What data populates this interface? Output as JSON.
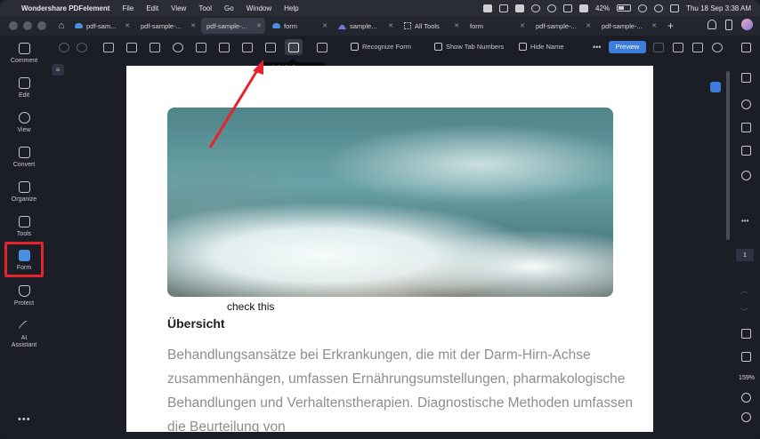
{
  "menubar": {
    "app_name": "Wondershare PDFelement",
    "menus": [
      "File",
      "Edit",
      "View",
      "Tool",
      "Go",
      "Window",
      "Help"
    ],
    "battery": "42%",
    "datetime": "Thu 18 Sep  3:38 AM"
  },
  "tabs": [
    {
      "label": "pdf-sam...",
      "icon": "cloud-icon",
      "active": false
    },
    {
      "label": "pdf-sample-...",
      "icon": "",
      "active": false
    },
    {
      "label": "pdf-sample-...",
      "icon": "",
      "active": true
    },
    {
      "label": "form",
      "icon": "cloud-icon",
      "active": false
    },
    {
      "label": "sample...",
      "icon": "chart-icon",
      "active": false
    },
    {
      "label": "All Tools",
      "icon": "grid-icon",
      "active": false
    },
    {
      "label": "form",
      "icon": "",
      "active": false
    },
    {
      "label": "pdf-sample-...",
      "icon": "",
      "active": false
    },
    {
      "label": "pdf-sample-...",
      "icon": "",
      "active": false
    }
  ],
  "sidebar": {
    "items": [
      {
        "label": "Comment",
        "icon": "comment-icon"
      },
      {
        "label": "Edit",
        "icon": "edit-icon"
      },
      {
        "label": "View",
        "icon": "eye-icon"
      },
      {
        "label": "Convert",
        "icon": "convert-icon"
      },
      {
        "label": "Organize",
        "icon": "organize-icon"
      },
      {
        "label": "Tools",
        "icon": "toolbox-icon"
      },
      {
        "label": "Form",
        "icon": "form-icon"
      },
      {
        "label": "Protect",
        "icon": "shield-icon"
      },
      {
        "label": "AI\nAssistant",
        "icon": "ai-wand-icon"
      }
    ],
    "more": "•••"
  },
  "toolbar": {
    "recognize_form": "Recognize Form",
    "show_tab_numbers": "Show Tab Numbers",
    "hide_name": "Hide Name",
    "more": "•••",
    "preview": "Preview",
    "tooltip": "Digital Signature"
  },
  "document": {
    "caption": "check this",
    "heading": "Übersicht",
    "paragraph": "Behandlungsansätze bei Erkrankungen, die mit der Darm-Hirn-Achse zusammenhängen, umfassen Ernährungsumstellungen, pharmakologische Behandlungen und Verhaltenstherapien. Diagnostische Methoden umfassen die Beurteilung von"
  },
  "rightpanel": {
    "page_number": "1",
    "zoom": "159%"
  },
  "colors": {
    "accent": "#3d7ddb",
    "highlight": "#e8222c"
  }
}
